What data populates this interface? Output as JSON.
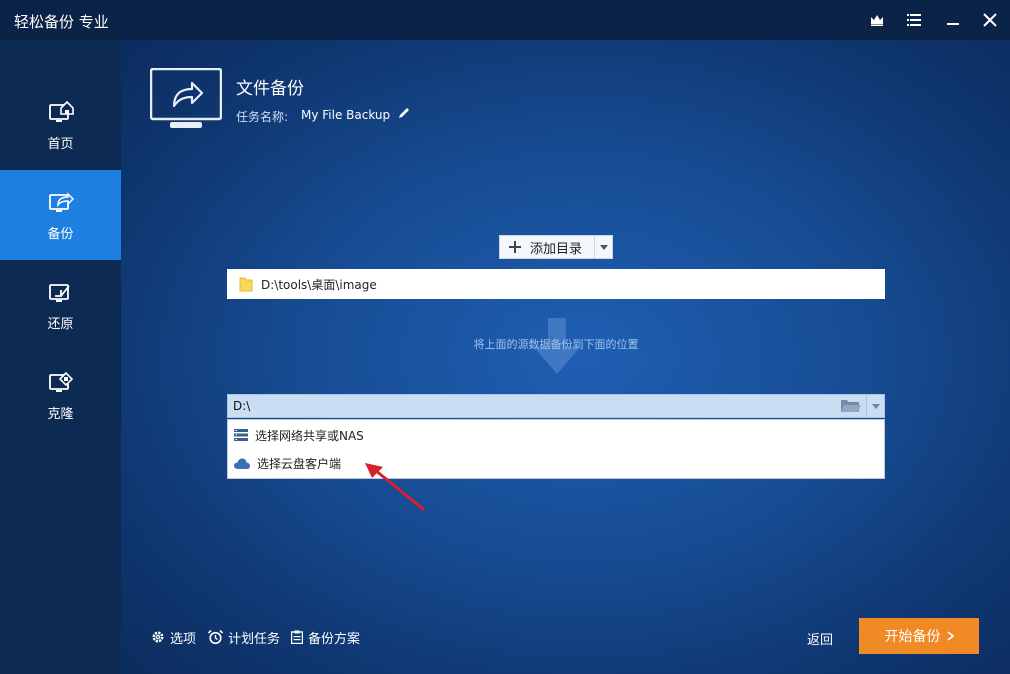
{
  "app": {
    "title": "轻松备份 专业"
  },
  "window_controls": [
    "crown-icon",
    "menu-icon",
    "minimize-icon",
    "close-icon"
  ],
  "sidebar": {
    "items": [
      {
        "label": "首页",
        "icon": "home-icon",
        "active": false
      },
      {
        "label": "备份",
        "icon": "backup-icon",
        "active": true
      },
      {
        "label": "还原",
        "icon": "restore-icon",
        "active": false
      },
      {
        "label": "克隆",
        "icon": "clone-icon",
        "active": false
      }
    ]
  },
  "header": {
    "title": "文件备份",
    "task_label": "任务名称:",
    "task_name": "My File Backup"
  },
  "source": {
    "add_button_label": "添加目录",
    "path": "D:\\tools\\桌面\\image"
  },
  "hint": "将上面的源数据备份到下面的位置",
  "destination": {
    "path": "D:\\",
    "options": [
      {
        "label": "选择网络共享或NAS",
        "icon": "network-server-icon"
      },
      {
        "label": "选择云盘客户端",
        "icon": "cloud-icon"
      }
    ]
  },
  "footer": {
    "options_label": "选项",
    "schedule_label": "计划任务",
    "scheme_label": "备份方案",
    "back_label": "返回",
    "start_label": "开始备份"
  },
  "colors": {
    "accent": "#1d7fe0",
    "start_button": "#f08a24",
    "sidebar_bg": "#0d2a52",
    "titlebar_bg": "#0b2347",
    "annotation_arrow": "#d8202a"
  }
}
